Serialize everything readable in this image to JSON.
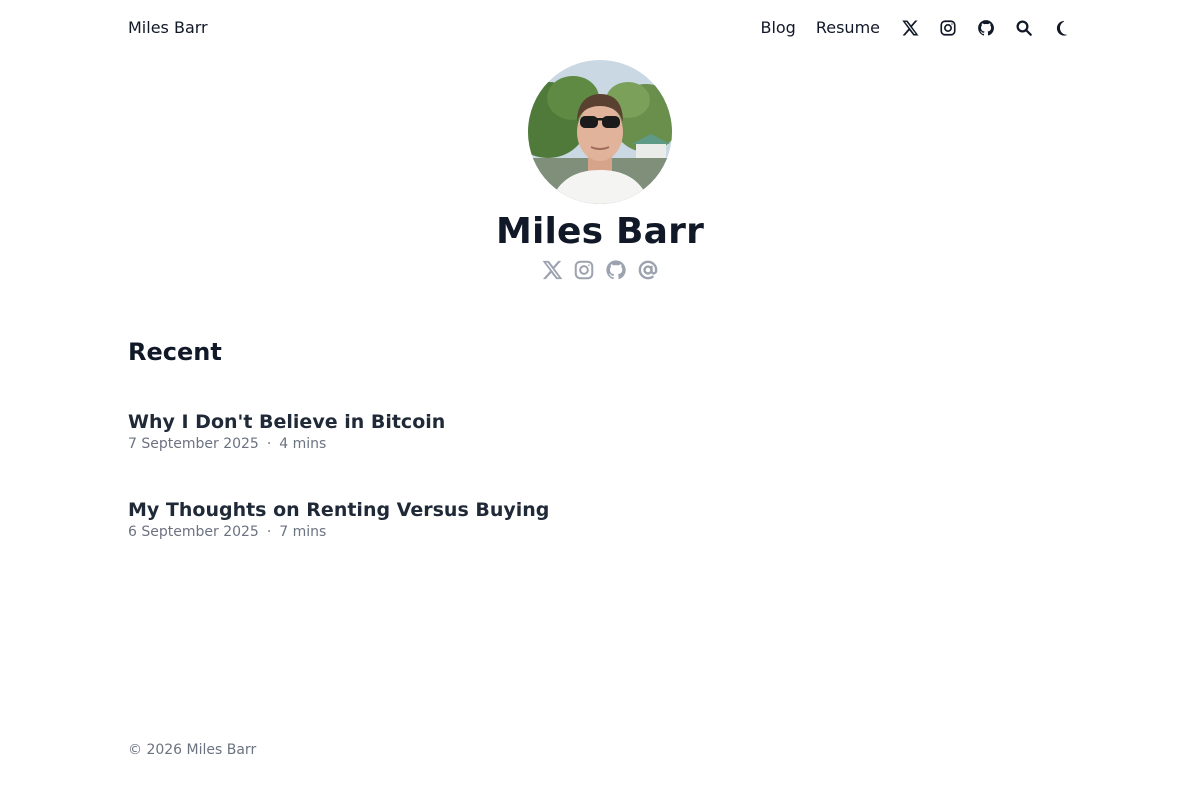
{
  "header": {
    "site_name": "Miles Barr",
    "nav_links": [
      "Blog",
      "Resume"
    ],
    "icons": [
      "x-twitter-icon",
      "instagram-icon",
      "github-icon",
      "search-icon",
      "moon-icon"
    ]
  },
  "profile": {
    "name": "Miles Barr",
    "avatar": "profile-photo",
    "social_icons": [
      "x-twitter-icon",
      "instagram-icon",
      "github-icon",
      "at-email-icon"
    ]
  },
  "recent": {
    "heading": "Recent",
    "posts": [
      {
        "title": "Why I Don't Believe in Bitcoin",
        "date": "7 September 2025",
        "separator": "·",
        "read_time": "4 mins"
      },
      {
        "title": "My Thoughts on Renting Versus Buying",
        "date": "6 September 2025",
        "separator": "·",
        "read_time": "7 mins"
      }
    ]
  },
  "footer": {
    "copyright": "© 2026 Miles Barr"
  },
  "colors": {
    "text_primary": "#111827",
    "text_muted": "#6b7280",
    "icon_muted": "#9ca3af",
    "background": "#ffffff"
  }
}
